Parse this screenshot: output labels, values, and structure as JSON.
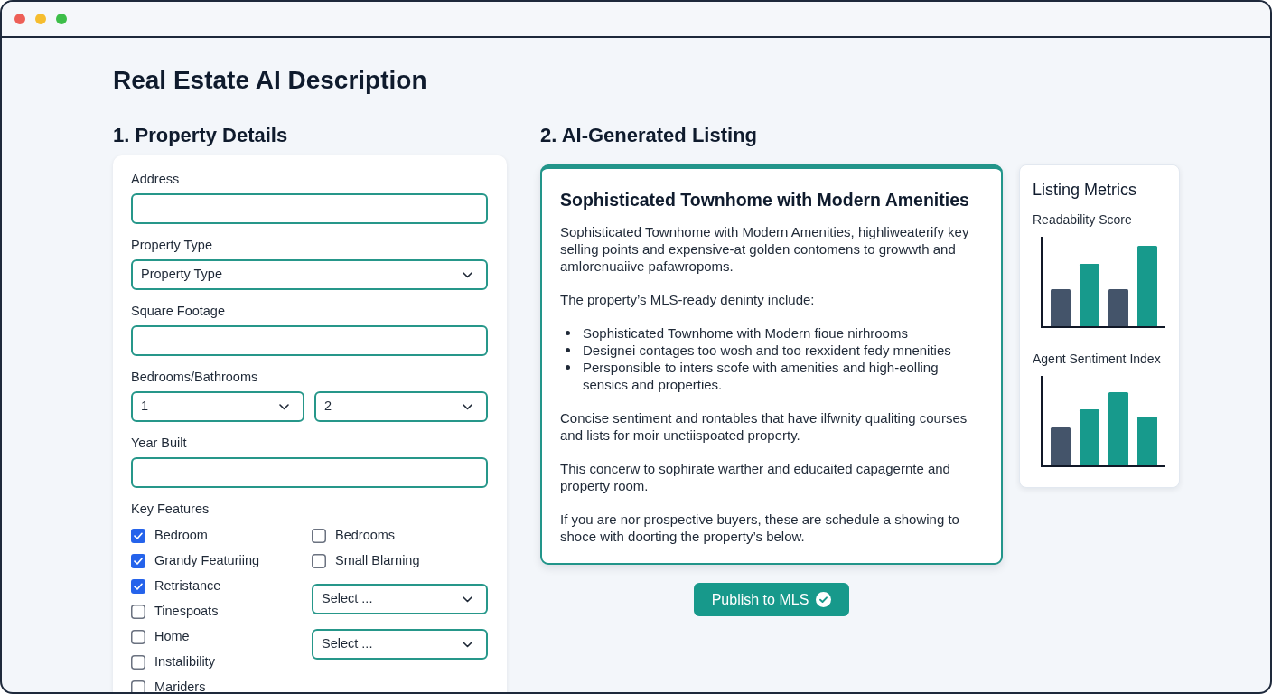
{
  "page_title": "Real Estate AI Description",
  "property_details": {
    "heading": "1. Property Details",
    "fields": [
      {
        "kind": "input",
        "label": "Address"
      },
      {
        "kind": "select",
        "label": "Property Type",
        "value": "Property Type"
      },
      {
        "kind": "input",
        "label": "Square Footage"
      },
      {
        "kind": "select_pair",
        "label": "Bedrooms/Bathrooms",
        "values": [
          "1",
          "2"
        ]
      },
      {
        "kind": "input",
        "label": "Year Built"
      }
    ],
    "key_features": {
      "label": "Key Features",
      "left": [
        {
          "label": "Bedroom",
          "checked": true
        },
        {
          "label": "Grandy Featuriing",
          "checked": true
        },
        {
          "label": "Retristance",
          "checked": true
        },
        {
          "label": "Tinespoats",
          "checked": false
        },
        {
          "label": "Home",
          "checked": false
        },
        {
          "label": "Instalibility",
          "checked": false
        },
        {
          "label": "Mariders",
          "checked": false
        }
      ],
      "right": [
        {
          "kind": "checkbox",
          "label": "Bedrooms",
          "checked": false
        },
        {
          "kind": "checkbox",
          "label": "Small Blarning",
          "checked": false
        },
        {
          "kind": "select",
          "value": "Select ..."
        },
        {
          "kind": "select",
          "value": "Select ..."
        }
      ]
    }
  },
  "listing": {
    "heading": "2. AI-Generated Listing",
    "title": "Sophisticated Townhome with Modern Amenities",
    "blocks": [
      {
        "kind": "paragraph",
        "text": "Sophisticated Townhome with Modern Amenities, highliweaterify key selling points and expensive-at golden contomens to growwth and amlorenuaiive pafawropoms."
      },
      {
        "kind": "paragraph",
        "text": "The property’s MLS-ready deninty include:"
      },
      {
        "kind": "list",
        "items": [
          "Sophisticated Townhome with Modern fioue nirhrooms",
          "Designei contages too wosh and too rexxident fedy mnenities",
          "Persponsible to inters scofe with amenities and high-eolling sensics and properties."
        ]
      },
      {
        "kind": "paragraph",
        "text": "Concise sentiment and rontables that have ilfwnity qualiting courses and lists for moir unetiispoated property."
      },
      {
        "kind": "paragraph",
        "text": "This concerw to sophirate warther and educaited capagernte and property room."
      },
      {
        "kind": "paragraph",
        "text": "If you are nor prospective buyers, these are schedule a showing to shoce with doorting the property’s below."
      }
    ],
    "publish_button": "Publish to MLS"
  },
  "metrics": {
    "title": "Listing Metrics",
    "charts": [
      {
        "title": "Readability Score"
      },
      {
        "title": "Agent Sentiment Index"
      }
    ]
  }
}
